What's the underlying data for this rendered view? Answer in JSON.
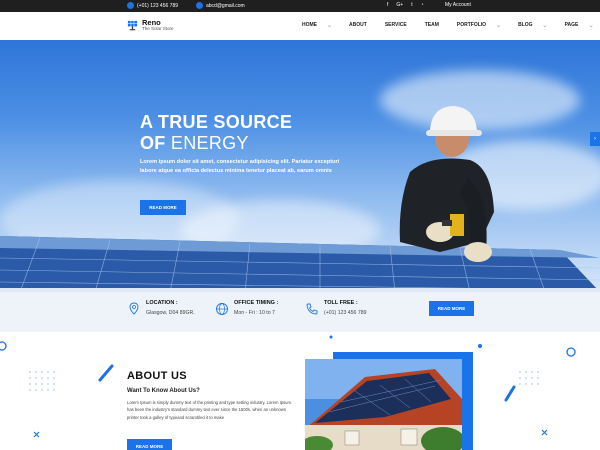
{
  "topbar": {
    "phone": "(+01) 123 456 789",
    "email": "abcd@gmail.com",
    "social_icons": [
      "facebook-icon",
      "google-plus-icon",
      "twitter-icon",
      "rss-icon"
    ],
    "social_glyphs": [
      "f",
      "G+",
      "t",
      "◔"
    ],
    "account": "My Account"
  },
  "header": {
    "logo_title": "Reno",
    "logo_subtitle": "The Solar Store",
    "nav": [
      {
        "label": "HOME",
        "caret": true
      },
      {
        "label": "ABOUT",
        "caret": false
      },
      {
        "label": "SERVICE",
        "caret": false
      },
      {
        "label": "TEAM",
        "caret": false
      },
      {
        "label": "PORTFOLIO",
        "caret": true
      },
      {
        "label": "BLOG",
        "caret": true
      },
      {
        "label": "PAGE",
        "caret": true
      }
    ]
  },
  "hero": {
    "title_line1": "A TRUE SOURCE",
    "title_line2_bold": "OF",
    "title_line2_normal": " ENERGY",
    "text": "Lorem ipsum dolor sit amet, consectetur adipisicing elit. Pariatur excepturi labore atque ea officia delectus minima tenetur placeat ab, earum omnis",
    "button": "READ MORE",
    "arrow": "›"
  },
  "info": {
    "location_label": "LOCATION :",
    "location_value": "Glasgow, D04 89GR.",
    "timing_label": "OFFICE TIMING :",
    "timing_value": "Mon - Fri : 10 to 7",
    "toll_label": "TOLL FREE :",
    "toll_value": "(+01) 123 456 789",
    "button": "READ MORE"
  },
  "about": {
    "title": "ABOUT US",
    "subtitle": "Want To Know About Us?",
    "text": "Lorem Ipsum is simply dummy text of the printing and type setting industry. Lorem Ipsum has been the industry's standard dummy text ever since the 1500s, when an unknown printer took a galley of typeand scrambled it to make",
    "button": "READ MORE"
  },
  "colors": {
    "accent": "#1a73e8",
    "topbar": "#1f1f1f",
    "infobar": "#eef3f9"
  }
}
